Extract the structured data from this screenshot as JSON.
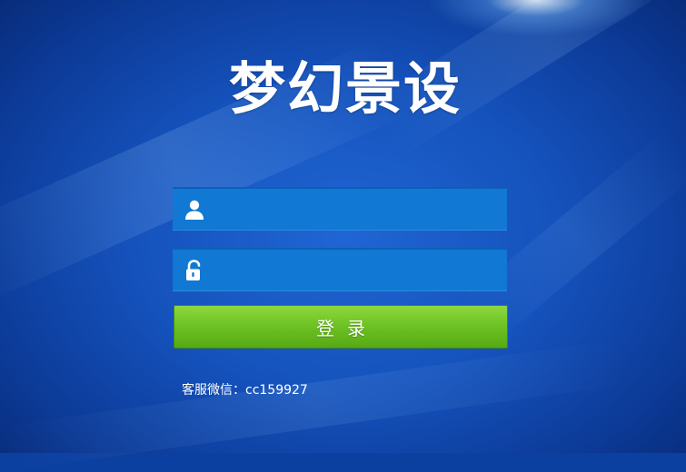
{
  "app": {
    "logo_text": "梦幻景设"
  },
  "login": {
    "username_placeholder": "",
    "username_value": "",
    "password_placeholder": "",
    "password_value": "",
    "submit_label": "登录"
  },
  "footer": {
    "contact_text": "客服微信：cc159927"
  },
  "icons": {
    "username": "user-icon",
    "password": "unlock-icon"
  },
  "colors": {
    "background": "#1552bc",
    "field": "#1178d3",
    "button": "#6cc123",
    "text": "#ffffff"
  }
}
